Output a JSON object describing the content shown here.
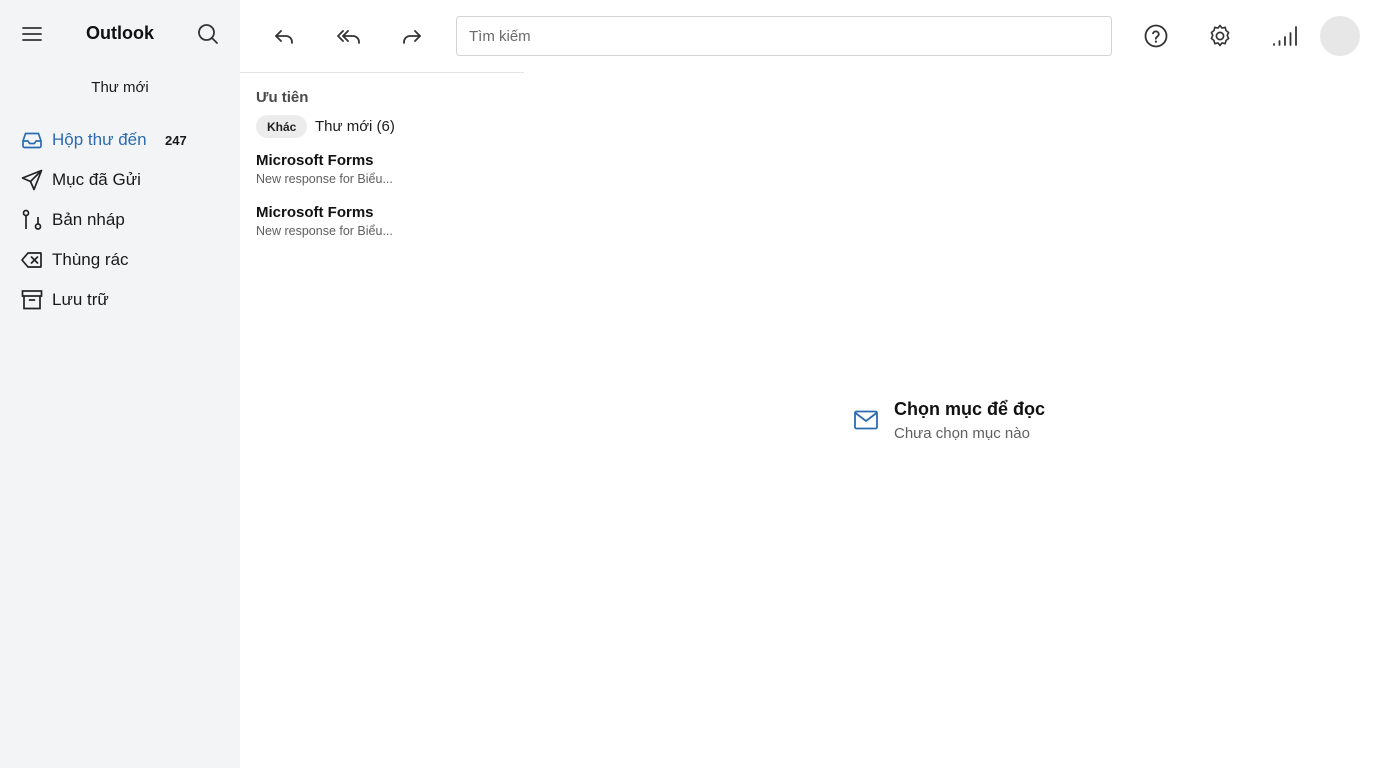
{
  "app": {
    "title": "Outlook"
  },
  "sidebar": {
    "new_mail_label": "Thư mới",
    "items": [
      {
        "label": "Hộp thư đến",
        "count": "247",
        "icon": "inbox-icon",
        "active": true
      },
      {
        "label": "Mục đã Gửi",
        "count": "",
        "icon": "send-icon",
        "active": false
      },
      {
        "label": "Bản nháp",
        "count": "",
        "icon": "draft-icon",
        "active": false
      },
      {
        "label": "Thùng rác",
        "count": "",
        "icon": "trash-icon",
        "active": false
      },
      {
        "label": "Lưu trữ",
        "count": "",
        "icon": "archive-icon",
        "active": false
      }
    ]
  },
  "toolbar": {
    "search_placeholder": "Tìm kiếm",
    "icons": [
      "reply-icon",
      "reply-all-icon",
      "forward-icon",
      "help-icon",
      "settings-icon",
      "signal-icon"
    ]
  },
  "list": {
    "focused_label": "Ưu tiên",
    "other_chip": "Khác",
    "other_new": "Thư mới (6)",
    "messages": [
      {
        "from": "Microsoft Forms",
        "preview": "New response for Biểu..."
      },
      {
        "from": "Microsoft Forms",
        "preview": "New response for Biểu..."
      }
    ]
  },
  "reading_pane": {
    "title": "Chọn mục để đọc",
    "subtitle": "Chưa chọn mục nào"
  },
  "colors": {
    "accent": "#2b6cb0",
    "sidebar_bg": "#f3f4f6"
  }
}
